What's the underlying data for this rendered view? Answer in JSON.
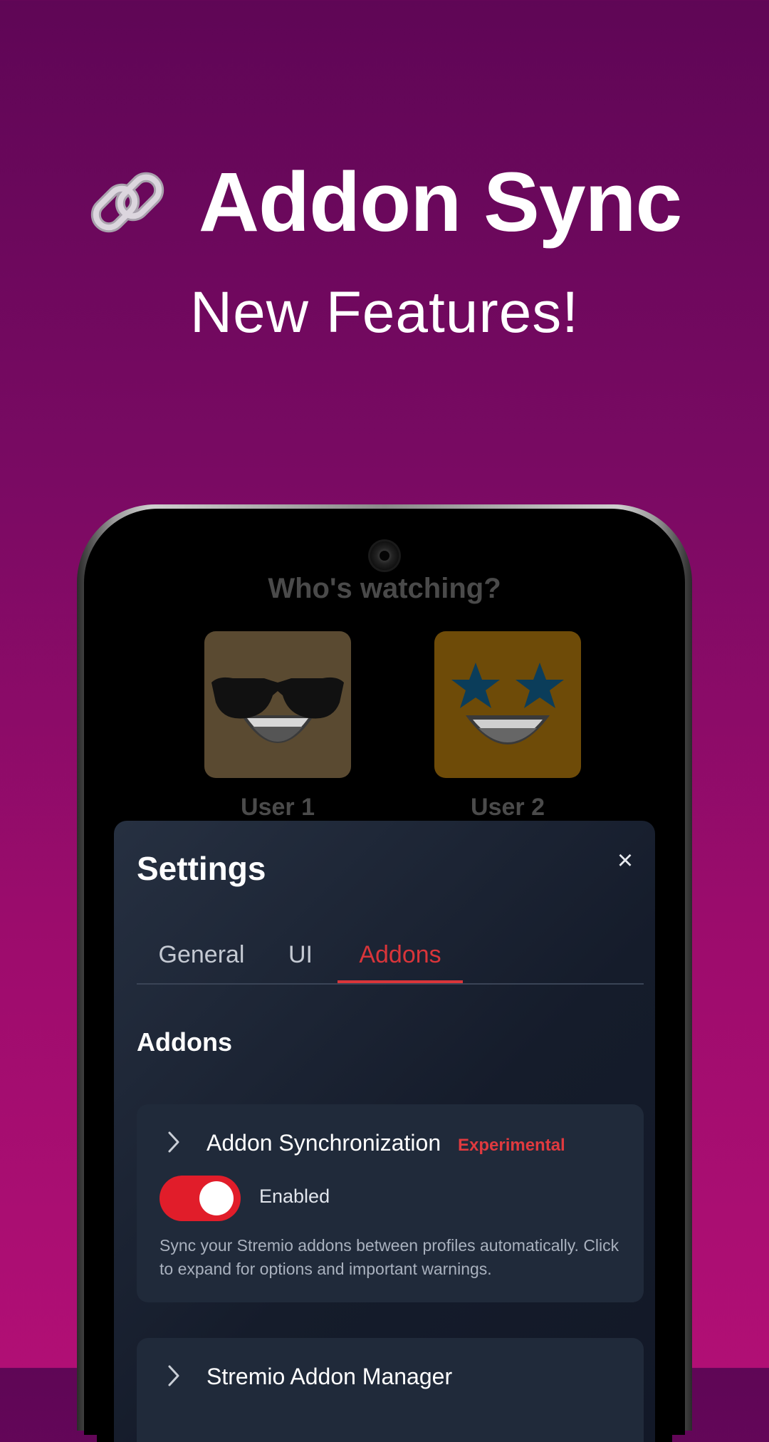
{
  "hero": {
    "title": "Addon Sync",
    "subtitle": "New Features!",
    "icon": "link-icon"
  },
  "profile_screen": {
    "title": "Who's watching?",
    "profiles": [
      {
        "name": "User 1",
        "avatar": "sunglasses-face-icon",
        "color": "#5a4a31"
      },
      {
        "name": "User 2",
        "avatar": "star-struck-face-icon",
        "color": "#6e4b08"
      }
    ]
  },
  "settings": {
    "title": "Settings",
    "close_icon": "×",
    "tabs": [
      {
        "label": "General",
        "active": false
      },
      {
        "label": "UI",
        "active": false
      },
      {
        "label": "Addons",
        "active": true
      }
    ],
    "section_title": "Addons",
    "cards": [
      {
        "title": "Addon Synchronization",
        "badge": "Experimental",
        "toggle_label": "Enabled",
        "toggle_on": true,
        "description": "Sync your Stremio addons between profiles automatically. Click to expand for options and important warnings."
      },
      {
        "title": "Stremio Addon Manager"
      }
    ]
  },
  "colors": {
    "accent": "#d9353a",
    "toggle_on": "#e11d2a",
    "background_top": "#5f0656",
    "background_bottom": "#b10f75"
  }
}
